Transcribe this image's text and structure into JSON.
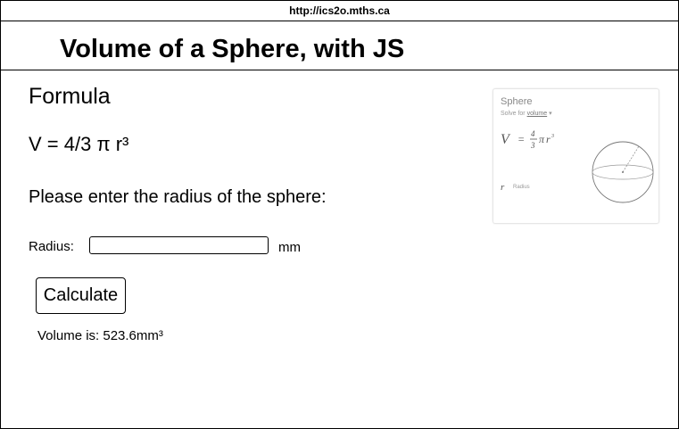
{
  "browser": {
    "url": "http://ics2o.mths.ca"
  },
  "header": {
    "title": "Volume of a Sphere, with JS"
  },
  "main": {
    "formula_heading": "Formula",
    "formula": "V = 4/3 π r³",
    "prompt": "Please enter the radius of the sphere:",
    "radius_label": "Radius:",
    "radius_value": "",
    "radius_unit": "mm",
    "calculate_label": "Calculate",
    "result": "Volume is: 523.6mm³"
  },
  "reference_card": {
    "title": "Sphere",
    "subtitle_prefix": "Solve for ",
    "subtitle_link": "volume",
    "subtitle_suffix": " ▾",
    "variable": "r",
    "variable_label": "Radius",
    "icon": "sphere-diagram-icon"
  }
}
